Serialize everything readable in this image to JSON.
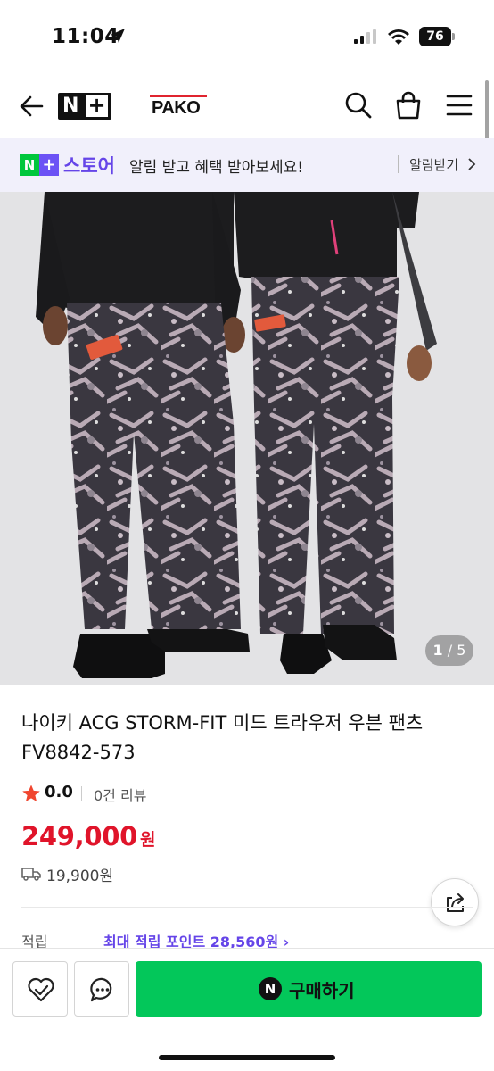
{
  "status_bar": {
    "time": "11:04",
    "battery": "76"
  },
  "nav": {
    "brand_logo": "N+",
    "store_brand": "PAKO"
  },
  "banner": {
    "logo_left": "N",
    "logo_right": "+",
    "store_name": "스토어",
    "message": "알림 받고 혜택 받아보세요!",
    "cta": "알림받기"
  },
  "gallery": {
    "current": "1",
    "separator": "/",
    "total": "5"
  },
  "product": {
    "title_line1": "나이키 ACG STORM-FIT 미드 트라우저 우븐 팬츠",
    "title_line2": "FV8842-573",
    "rating": "0.0",
    "reviews": "0건 리뷰",
    "price": "249,000",
    "price_unit": "원",
    "shipping_fee": "19,900원",
    "points_label": "적립",
    "points_value": "최대 적립 포인트 28,560원 ›"
  },
  "actions": {
    "buy_badge": "N",
    "buy_label": "구매하기"
  },
  "colors": {
    "naver_green": "#03c75a",
    "price_red": "#e0142a",
    "accent_purple": "#6545e8"
  }
}
